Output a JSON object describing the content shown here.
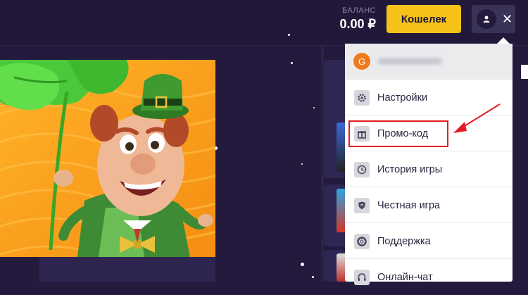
{
  "header": {
    "balance_label": "БАЛАНС",
    "balance_value": "0.00 ₽",
    "wallet_label": "Кошелек",
    "close_symbol": "✕"
  },
  "dropdown": {
    "avatar_letter": "G",
    "menu_items": [
      {
        "label": "Настройки",
        "icon": "gear-icon"
      },
      {
        "label": "Промо-код",
        "icon": "gift-icon"
      },
      {
        "label": "История игры",
        "icon": "clock-icon"
      },
      {
        "label": "Честная игра",
        "icon": "shield-icon"
      },
      {
        "label": "Поддержка",
        "icon": "lifebuoy-icon"
      },
      {
        "label": "Онлайн-чат",
        "icon": "headset-icon"
      }
    ]
  },
  "colors": {
    "background": "#231a3d",
    "accent": "#f6c21a",
    "highlight": "#e31b23",
    "avatar": "#f07a1a"
  }
}
